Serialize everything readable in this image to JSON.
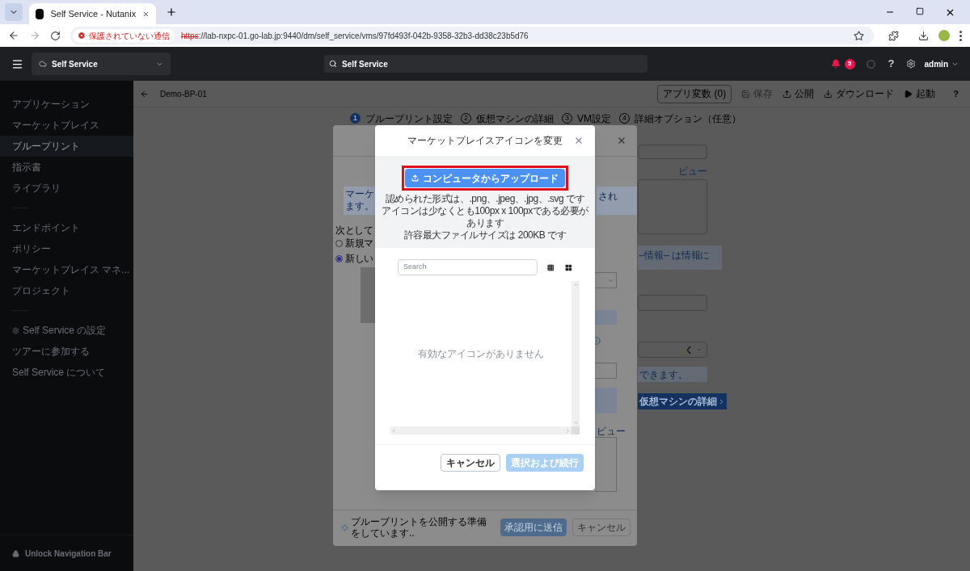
{
  "browser": {
    "tab_title": "Self Service - Nutanix",
    "security_label": "保護されていない通信",
    "url_scheme": "https",
    "url_rest": "://lab-nxpc-01.go-lab.jp:9440/dm/self_service/vms/97fd493f-042b-9358-32b3-dd38c23b5d76"
  },
  "header": {
    "app_name": "Self Service",
    "search_value": "Self Service",
    "alert_count": "5",
    "help": "?",
    "user": "admin"
  },
  "sidebar": {
    "sections": [
      [
        {
          "label": "アプリケーション",
          "kind": "plain",
          "selected": false
        },
        {
          "label": "マーケットプレイス",
          "kind": "plain",
          "selected": false
        },
        {
          "label": "ブループリント",
          "kind": "plain",
          "selected": true
        },
        {
          "label": "指示書",
          "kind": "plain",
          "selected": false
        },
        {
          "label": "ライブラリ",
          "kind": "plain",
          "selected": false
        }
      ],
      [
        {
          "label": "エンドポイント",
          "kind": "plain",
          "selected": false
        },
        {
          "label": "ポリシー",
          "kind": "plain",
          "selected": false
        },
        {
          "label": "マーケットプレイス マネ...",
          "kind": "plain",
          "selected": false
        },
        {
          "label": "プロジェクト",
          "kind": "plain",
          "selected": false
        }
      ],
      [
        {
          "label": "Self Service の設定",
          "kind": "settings",
          "selected": false
        },
        {
          "label": "ツアーに参加する",
          "kind": "plain",
          "selected": false
        },
        {
          "label": "Self Service について",
          "kind": "plain",
          "selected": false
        }
      ]
    ],
    "footer": "Unlock Navigation Bar"
  },
  "page": {
    "title": "Demo-BP-01",
    "actions": [
      {
        "kind": "outlined",
        "label": "アプリ変数",
        "count": "(0)",
        "disabled": false
      },
      {
        "kind": "save",
        "label": "保存",
        "disabled": true
      },
      {
        "kind": "publish",
        "label": "公開",
        "disabled": false
      },
      {
        "kind": "download",
        "label": "ダウンロード",
        "disabled": false
      },
      {
        "kind": "launch",
        "label": "起動",
        "disabled": false
      },
      {
        "kind": "help",
        "label": "?",
        "disabled": false
      }
    ],
    "steps": [
      {
        "number": "1",
        "label": "ブループリント設定",
        "selected": true
      },
      {
        "number": "2",
        "label": "仮想マシンの詳細",
        "selected": false
      },
      {
        "number": "3",
        "label": "VM設定",
        "selected": false
      },
      {
        "number": "4",
        "label": "詳細オプション（任意）",
        "selected": false
      }
    ],
    "form": {
      "link": "ビュー",
      "info_text": "--情報-- は情報に",
      "note_text": "できます。",
      "next_button": "仮想マシンの詳細"
    }
  },
  "publish_dialog": {
    "info_lines": [
      "マーケ",
      "ます。"
    ],
    "info_tail": "され",
    "prompt": "次として",
    "options": [
      {
        "label": "新規マ",
        "selected": false
      },
      {
        "label": "新しい",
        "selected": true
      }
    ],
    "link": "ビュー",
    "status": "ブループリントを公開する準備をしています..",
    "buttons": [
      {
        "label": "承認用に送信",
        "kind": "primary"
      },
      {
        "label": "キャンセル",
        "kind": "secondary"
      }
    ]
  },
  "icon_dialog": {
    "title": "マーケットプレイスアイコンを変更",
    "upload_button": "コンピュータからアップロード",
    "highlighted": true,
    "requirements": [
      "認められた形式は、.png、.jpeg、.jpg、.svg です",
      "アイコンは少なくとも100px x 100pxである必要があります",
      "許容最大ファイルサイズは 200KB です"
    ],
    "search_placeholder": "Search",
    "views": [
      {
        "kind": "small-grid"
      },
      {
        "kind": "large-grid"
      }
    ],
    "empty_message": "有効なアイコンがありません",
    "buttons": [
      {
        "label": "キャンセル",
        "kind": "secondary",
        "disabled": false
      },
      {
        "label": "選択および続行",
        "kind": "primary",
        "disabled": true
      }
    ]
  }
}
